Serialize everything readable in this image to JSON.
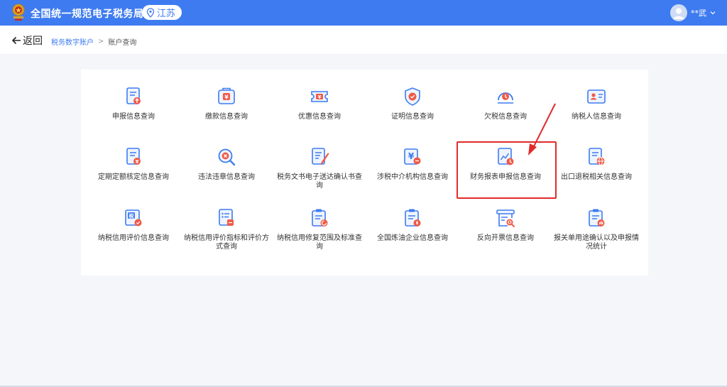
{
  "header": {
    "app_title": "全国统一规范电子税务局",
    "region": "江苏",
    "user_name": "**武",
    "brand_color": "#3e7bf0"
  },
  "nav": {
    "back_label": "返回",
    "breadcrumb": {
      "parent": "税务数字账户",
      "separator": ">",
      "current": "账户查询"
    }
  },
  "services": [
    {
      "label": "申报信息查询",
      "icon": "document-upload-icon"
    },
    {
      "label": "缴款信息查询",
      "icon": "wallet-yuan-icon"
    },
    {
      "label": "优惠信息查询",
      "icon": "ticket-yuan-icon"
    },
    {
      "label": "证明信息查询",
      "icon": "certificate-shield-icon"
    },
    {
      "label": "欠税信息查询",
      "icon": "arrears-gauge-icon"
    },
    {
      "label": "纳税人信息查询",
      "icon": "id-card-icon"
    },
    {
      "label": "定期定额核定信息查询",
      "icon": "document-yuan-icon"
    },
    {
      "label": "违法违章信息查询",
      "icon": "violation-search-icon"
    },
    {
      "label": "税务文书电子送达确认书查询",
      "icon": "document-pen-icon"
    },
    {
      "label": "涉税中介机构信息查询",
      "icon": "agency-yuan-icon"
    },
    {
      "label": "财务报表申报信息查询",
      "icon": "financial-report-icon"
    },
    {
      "label": "出口退税相关信息查询",
      "icon": "export-globe-icon"
    },
    {
      "label": "纳税信用评价信息查询",
      "icon": "tax-credit-icon"
    },
    {
      "label": "纳税信用评价指标和评价方式查询",
      "icon": "credit-list-icon"
    },
    {
      "label": "纳税信用修复范围及标准查询",
      "icon": "clipboard-repair-icon"
    },
    {
      "label": "全国炼油企业信息查询",
      "icon": "clipboard-refinery-icon"
    },
    {
      "label": "反向开票信息查询",
      "icon": "invoice-search-icon"
    },
    {
      "label": "报关单用途确认以及申报情况统计",
      "icon": "clipboard-stats-icon"
    }
  ]
}
